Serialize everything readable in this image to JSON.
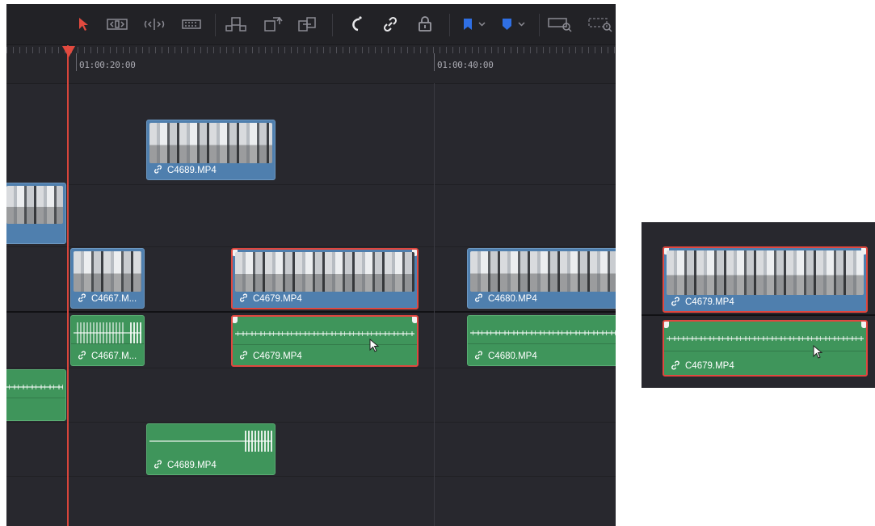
{
  "toolbar": {
    "tools": [
      {
        "name": "selection-tool",
        "icon": "arrow-pointer-icon",
        "active": true
      },
      {
        "name": "trim-edit-tool",
        "icon": "trim-icon"
      },
      {
        "name": "dynamic-trim-tool",
        "icon": "dynamic-trim-icon"
      },
      {
        "name": "blade-tool",
        "icon": "blade-icon"
      },
      {
        "name": "insert-clip",
        "icon": "insert-clip-icon"
      },
      {
        "name": "overwrite-clip",
        "icon": "overwrite-clip-icon"
      },
      {
        "name": "replace-clip",
        "icon": "replace-clip-icon"
      },
      {
        "name": "snapping",
        "icon": "magnet-icon"
      },
      {
        "name": "linked-selection",
        "icon": "link-icon"
      },
      {
        "name": "position-lock",
        "icon": "lock-icon"
      },
      {
        "name": "flag",
        "icon": "flag-icon",
        "color": "#2f6fe4"
      },
      {
        "name": "marker",
        "icon": "marker-icon",
        "color": "#2f6fe4"
      },
      {
        "name": "zoom-full",
        "icon": "zoom-full-icon"
      },
      {
        "name": "zoom-detail",
        "icon": "zoom-detail-icon"
      }
    ]
  },
  "ruler": {
    "timecodes": [
      "01:00:20:00",
      "01:00:40:00"
    ]
  },
  "clips": {
    "c4689_video": "C4689.MP4",
    "c4667_video": "C4667.M...",
    "c4679_video": "C4679.MP4",
    "c4680_video": "C4680.MP4",
    "c4667_audio": "C4667.M...",
    "c4679_audio": "C4679.MP4",
    "c4680_audio": "C4680.MP4",
    "c4689_audio": "C4689.MP4"
  },
  "inset": {
    "video_label": "C4679.MP4",
    "audio_label": "C4679.MP4"
  },
  "colors": {
    "video_clip": "#4f7fae",
    "audio_clip": "#3f955b",
    "selection": "#e0473f",
    "playhead": "#d8453b",
    "background": "#28282e"
  }
}
